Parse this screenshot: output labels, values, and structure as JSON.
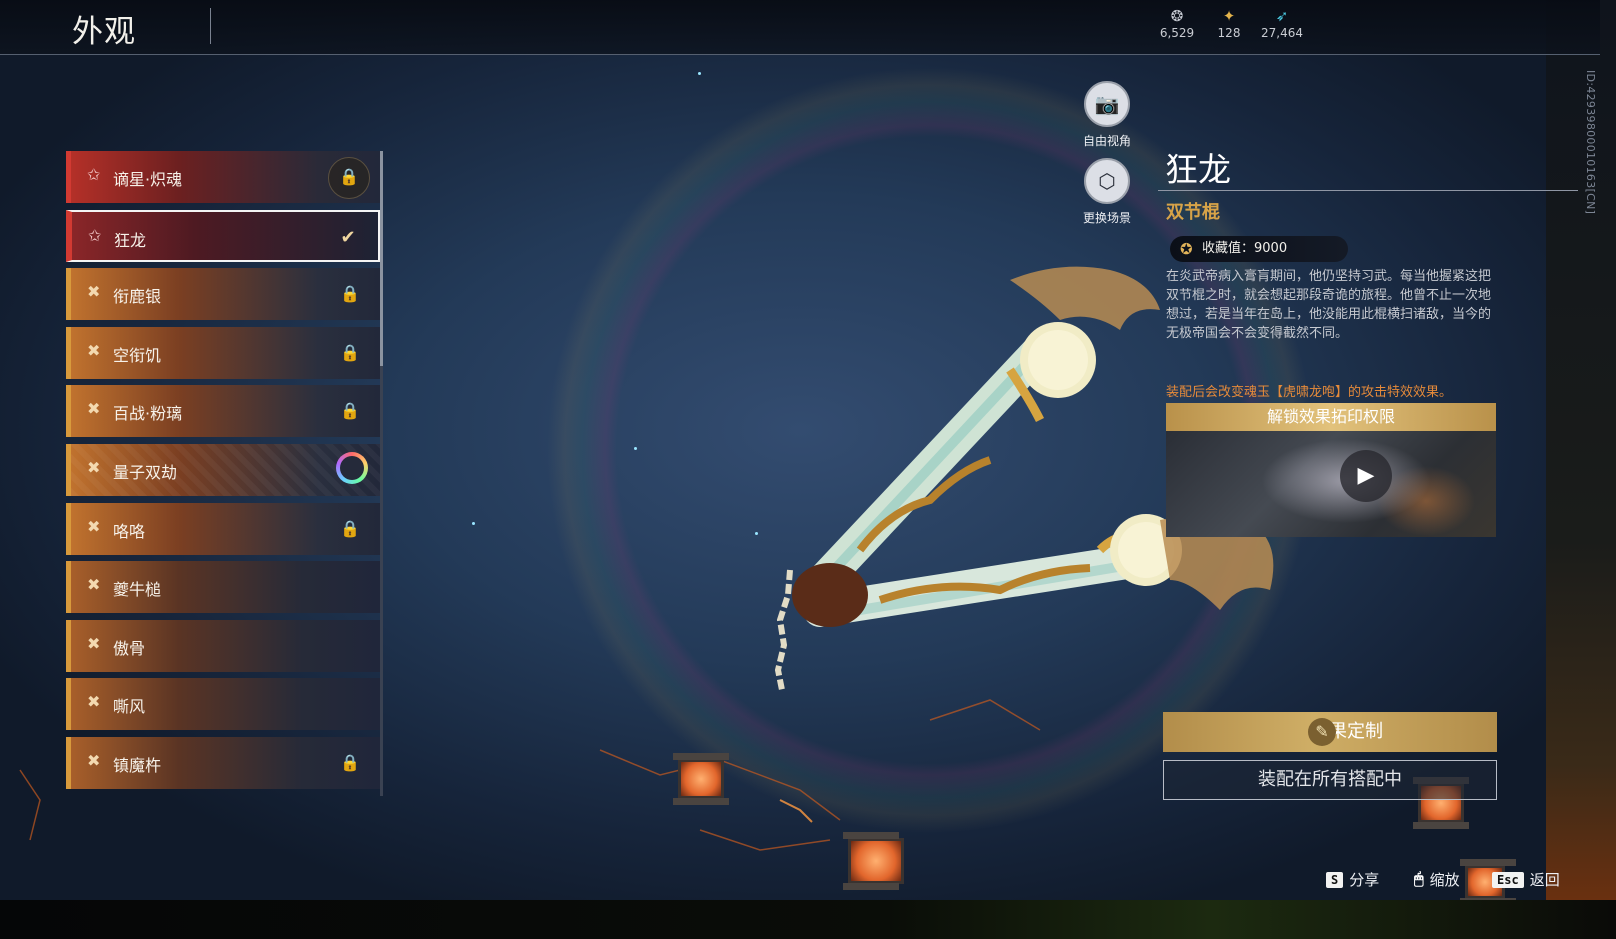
{
  "header": {
    "title": "外观",
    "currencies": [
      {
        "icon": "coin-stack-icon",
        "glyph": "❂",
        "amount": "6,529",
        "color": "#c8ccd4"
      },
      {
        "icon": "gold-ticket-icon",
        "glyph": "✦",
        "amount": "128",
        "color": "#e4b44c"
      },
      {
        "icon": "feather-icon",
        "glyph": "➶",
        "amount": "27,464",
        "color": "#4ac8e0"
      }
    ]
  },
  "side_id": "ID:42939800010163[CN]",
  "items": [
    {
      "name": "谪星·炽魂",
      "rank_glyph": "✩",
      "state": "lock-ring",
      "state_glyph": "🔒",
      "style": "red"
    },
    {
      "name": "狂龙",
      "rank_glyph": "✩",
      "state": "check",
      "state_glyph": "✔",
      "style": "selected"
    },
    {
      "name": "衔鹿银",
      "rank_glyph": "✖",
      "state": "lock",
      "state_glyph": "🔒",
      "style": "gold"
    },
    {
      "name": "空衔饥",
      "rank_glyph": "✖",
      "state": "lock",
      "state_glyph": "🔒",
      "style": "gold"
    },
    {
      "name": "百战·粉璃",
      "rank_glyph": "✖",
      "state": "lock",
      "state_glyph": "🔒",
      "style": "gold"
    },
    {
      "name": "量子双劫",
      "rank_glyph": "✖",
      "state": "gradient-ring",
      "state_glyph": "",
      "style": "pattern"
    },
    {
      "name": "咯咯",
      "rank_glyph": "✖",
      "state": "lock",
      "state_glyph": "🔒",
      "style": "gold"
    },
    {
      "name": "夔牛槌",
      "rank_glyph": "✖",
      "state": "none",
      "state_glyph": "",
      "style": "muted"
    },
    {
      "name": "傲骨",
      "rank_glyph": "✖",
      "state": "none",
      "state_glyph": "",
      "style": "muted"
    },
    {
      "name": "嘶风",
      "rank_glyph": "✖",
      "state": "none",
      "state_glyph": "",
      "style": "muted"
    },
    {
      "name": "镇魔杵",
      "rank_glyph": "✖",
      "state": "lock",
      "state_glyph": "🔒",
      "style": "muted"
    }
  ],
  "camera": {
    "free_view": {
      "label": "自由视角",
      "glyph": "📷"
    },
    "change_scene": {
      "label": "更换场景",
      "glyph": "⬡"
    }
  },
  "detail": {
    "name": "狂龙",
    "type": "双节棍",
    "collection": "收藏值：9000",
    "description": "在炎武帝病入膏肓期间，他仍坚持习武。每当他握紧这把双节棍之时，就会想起那段奇诡的旅程。他曾不止一次地想过，若是当年在岛上，他没能用此棍横扫诸敌，当今的无极帝国会不会变得截然不同。",
    "effect_note": "装配后会改变魂玉【虎啸龙咆】的攻击特效效果。",
    "unlock_header": "解锁效果拓印权限",
    "customize_label": "效果定制",
    "equip_all_label": "装配在所有搭配中"
  },
  "hints": [
    {
      "key": "S",
      "label": "分享",
      "mouse": false
    },
    {
      "key": "🖱",
      "label": "缩放",
      "mouse": true
    },
    {
      "key": "Esc",
      "label": "返回",
      "mouse": false
    }
  ],
  "colors": {
    "accent_gold": "#d7a348",
    "accent_red": "#d23a32",
    "note_orange": "#e58a3a"
  }
}
